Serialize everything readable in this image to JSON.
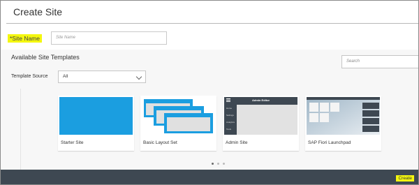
{
  "header": {
    "title": "Create Site"
  },
  "site_name": {
    "label": "*Site Name",
    "placeholder": "Site Name"
  },
  "templates": {
    "heading": "Available Site Templates",
    "search_placeholder": "Search",
    "source_label": "Template Source",
    "source_value": "All",
    "cards": [
      {
        "label": "Starter Site"
      },
      {
        "label": "Basic Layout Set"
      },
      {
        "label": "Admin Site",
        "preview_title": "Admin Editor",
        "preview_menu": [
          "Home",
          "Settings",
          "Analytics",
          "Tools"
        ]
      },
      {
        "label": "SAP Fiori Launchpad"
      }
    ],
    "pagination": {
      "pages": 3,
      "current": 1
    }
  },
  "footer": {
    "create_label": "Create"
  },
  "colors": {
    "highlight": "#f4f70f",
    "footer_bg": "#3e4852",
    "starter_blue": "#1b9ee0",
    "admin_dark": "#3e4852"
  }
}
